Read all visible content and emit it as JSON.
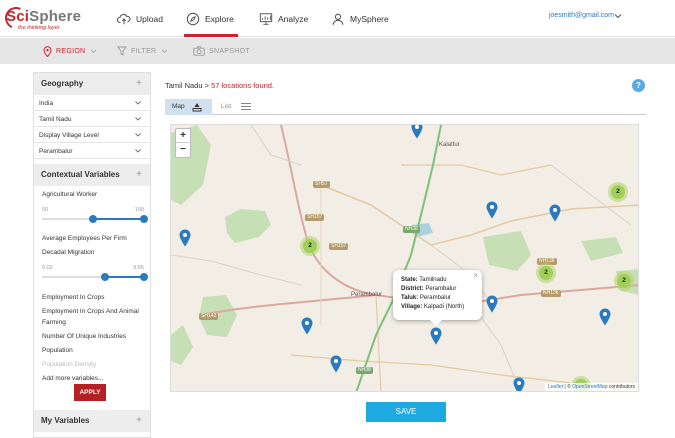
{
  "brand": {
    "name_prefix": "Sci",
    "name_suffix": "Sphere",
    "tagline": "the thinking layer"
  },
  "nav": [
    {
      "label": "Upload",
      "icon": "cloud-upload-icon"
    },
    {
      "label": "Explore",
      "icon": "compass-icon",
      "active": true
    },
    {
      "label": "Analyze",
      "icon": "presentation-chart-icon"
    },
    {
      "label": "MySphere",
      "icon": "user-icon"
    }
  ],
  "user": {
    "email": "joesmith@gmail.com"
  },
  "subnav": {
    "region": "REGION",
    "filter": "FILTER",
    "snapshot": "SNAPSHOT"
  },
  "sidebar": {
    "geography": {
      "title": "Geography",
      "rows": [
        "India",
        "Tamil Nadu",
        "Display Village Level",
        "Perambalur"
      ]
    },
    "contextual": {
      "title": "Contextual Variables",
      "agri": {
        "label": "Agricultural Worker",
        "min": "50",
        "max": "100",
        "low": 0.5,
        "high": 1.0
      },
      "employees": "Average Employees Per Firm",
      "decadal": {
        "label": "Decadal Migration",
        "min": "0.02",
        "max": "9.65",
        "low": 0.62,
        "high": 1.0
      },
      "items": [
        "Employment In Crops",
        "Employment In Crops And Animal",
        "Farming",
        "Number Of Unique Industries",
        "Population",
        "Population Density",
        "Add more variables..."
      ],
      "apply": "APPLY"
    },
    "myvars": {
      "title": "My Variables"
    }
  },
  "main": {
    "breadcrumb": "Tamil Nadu >",
    "count": "57 locations found.",
    "help": "?",
    "tabs": {
      "map": "Map",
      "list": "List"
    }
  },
  "map": {
    "places": [
      "Kalattur",
      "Perambalur"
    ],
    "roads": [
      "SH57",
      "SH157",
      "SH157",
      "NH38",
      "NH136",
      "NH136",
      "SH142",
      "NH38"
    ],
    "clusters": [
      "2",
      "2",
      "2",
      "2"
    ],
    "popup": {
      "state_label": "State:",
      "state": "Tamilnadu",
      "district_label": "District:",
      "district": "Perambalur",
      "taluk_label": "Taluk:",
      "taluk": "Perambalur",
      "village_label": "Village:",
      "village": "Kalpadi (North)"
    },
    "attribution": {
      "leaflet": "Leaflet",
      "sep": " | © ",
      "osm": "OpenStreetMap",
      "suffix": " contributors"
    },
    "zoom_in": "+",
    "zoom_out": "−"
  },
  "save": "SAVE",
  "colors": {
    "accent": "#c6252d",
    "link": "#2a7ac0",
    "save": "#1fa9e1",
    "pin": "#2a7ac0"
  }
}
